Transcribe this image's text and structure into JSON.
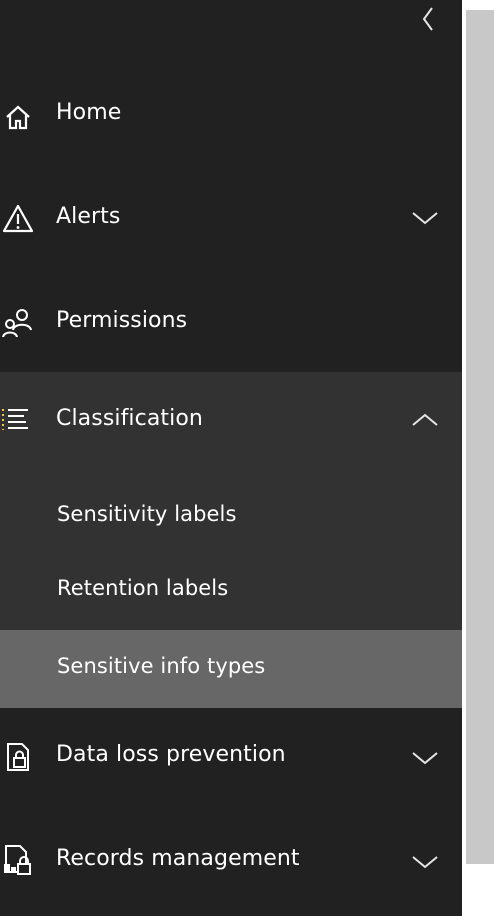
{
  "sidebar": {
    "collapse_label": "<",
    "items": [
      {
        "label": "Home",
        "icon": "home-icon",
        "has_chevron": false
      },
      {
        "label": "Alerts",
        "icon": "warning-icon",
        "has_chevron": true,
        "expanded": false
      },
      {
        "label": "Permissions",
        "icon": "people-icon",
        "has_chevron": false
      },
      {
        "label": "Classification",
        "icon": "list-icon",
        "has_chevron": true,
        "expanded": true,
        "children": [
          {
            "label": "Sensitivity labels",
            "selected": false
          },
          {
            "label": "Retention labels",
            "selected": false
          },
          {
            "label": "Sensitive info types",
            "selected": true
          }
        ]
      },
      {
        "label": "Data loss prevention",
        "icon": "dlp-lock-icon",
        "has_chevron": true,
        "expanded": false
      },
      {
        "label": "Records management",
        "icon": "records-icon",
        "has_chevron": true,
        "expanded": false
      }
    ]
  },
  "colors": {
    "sidebar_bg": "#212121",
    "group_bg": "#323232",
    "selected_bg": "#676767",
    "text": "#ffffff",
    "scrollbar": "#c8c8c8"
  }
}
